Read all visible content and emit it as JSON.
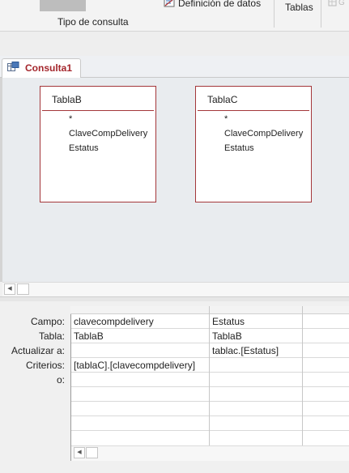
{
  "ribbon": {
    "query_type_label": "Tipo de consulta",
    "data_definition_label": "Definición de datos",
    "tables_label": "Tablas"
  },
  "document_tab": {
    "label": "Consulta1"
  },
  "tables": [
    {
      "title": "TablaB",
      "fields": [
        "*",
        "ClaveCompDelivery",
        "Estatus"
      ]
    },
    {
      "title": "TablaC",
      "fields": [
        "*",
        "ClaveCompDelivery",
        "Estatus"
      ]
    }
  ],
  "grid": {
    "row_labels": [
      "Campo:",
      "Tabla:",
      "Actualizar a:",
      "Criterios:",
      "o:"
    ],
    "columns": [
      {
        "campo": "clavecompdelivery",
        "tabla": "TablaB",
        "actualizar": "",
        "criterios": "[tablaC].[clavecompdelivery]",
        "o": ""
      },
      {
        "campo": "Estatus",
        "tabla": "TablaB",
        "actualizar": "tablac.[Estatus]",
        "criterios": "",
        "o": ""
      },
      {
        "campo": "",
        "tabla": "",
        "actualizar": "",
        "criterios": "",
        "o": ""
      }
    ]
  }
}
